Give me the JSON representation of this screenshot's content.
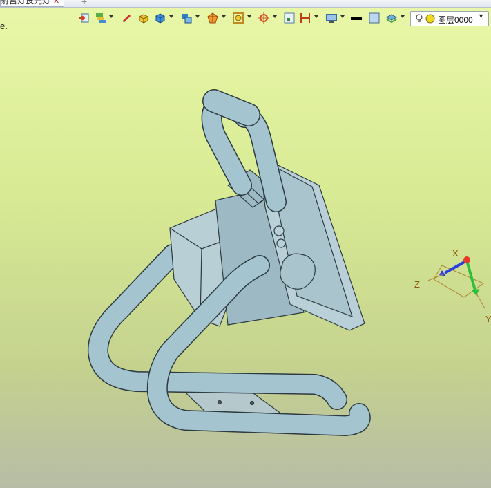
{
  "tab": {
    "title": "射宫灯投光灯",
    "close_glyph": "✕",
    "new_tab_glyph": "+"
  },
  "side_text": "e.",
  "toolbar": {
    "items": [
      {
        "name": "import-icon",
        "has_dropdown": false
      },
      {
        "name": "layer-tools-icon",
        "has_dropdown": true
      },
      {
        "name": "pen-icon",
        "has_dropdown": false
      },
      {
        "name": "box-yellow-icon",
        "has_dropdown": false
      },
      {
        "name": "cube-icon",
        "has_dropdown": true
      },
      {
        "name": "shaded-view-icon",
        "has_dropdown": true
      },
      {
        "name": "render-mode-icon",
        "has_dropdown": true
      },
      {
        "name": "frame-select-icon",
        "has_dropdown": true
      },
      {
        "name": "snap-target-icon",
        "has_dropdown": true
      },
      {
        "name": "zoom-window-icon",
        "has_dropdown": false
      },
      {
        "name": "measure-icon",
        "has_dropdown": true
      },
      {
        "name": "display-settings-icon",
        "has_dropdown": true
      },
      {
        "name": "line-color-swatch",
        "has_dropdown": false
      },
      {
        "name": "fill-color-swatch",
        "has_dropdown": false
      },
      {
        "name": "layers-icon",
        "has_dropdown": true
      }
    ],
    "layer_select": {
      "value": "图层0000"
    }
  },
  "colors": {
    "accent_red": "#e0301e",
    "axis_x": "#e53a2a",
    "axis_y": "#2fbf3a",
    "axis_z": "#2b3ee0",
    "model_fill": "#a4c4cf"
  },
  "triad": {
    "x_label": "X",
    "y_label": "Y",
    "z_label": "Z"
  }
}
